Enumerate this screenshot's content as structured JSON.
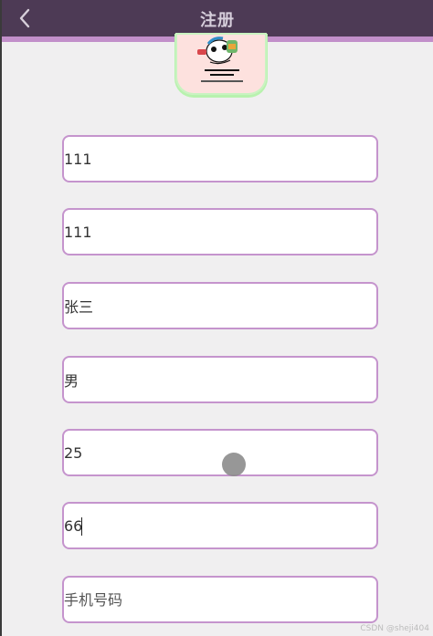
{
  "header": {
    "title": "注册",
    "back_icon": "chevron-left-icon"
  },
  "avatar": {
    "icon": "cartoon-avatar-image"
  },
  "form": {
    "fields": [
      {
        "value": "111",
        "placeholder": ""
      },
      {
        "value": "111",
        "placeholder": ""
      },
      {
        "value": "张三",
        "placeholder": ""
      },
      {
        "value": "男",
        "placeholder": ""
      },
      {
        "value": "25",
        "placeholder": ""
      },
      {
        "value": "66",
        "placeholder": ""
      },
      {
        "value": "",
        "placeholder": "手机号码"
      }
    ]
  },
  "watermark": "CSDN @sheji404",
  "colors": {
    "header_bg": "#4d3a55",
    "accent": "#c594cd",
    "background": "#f0eff0"
  }
}
